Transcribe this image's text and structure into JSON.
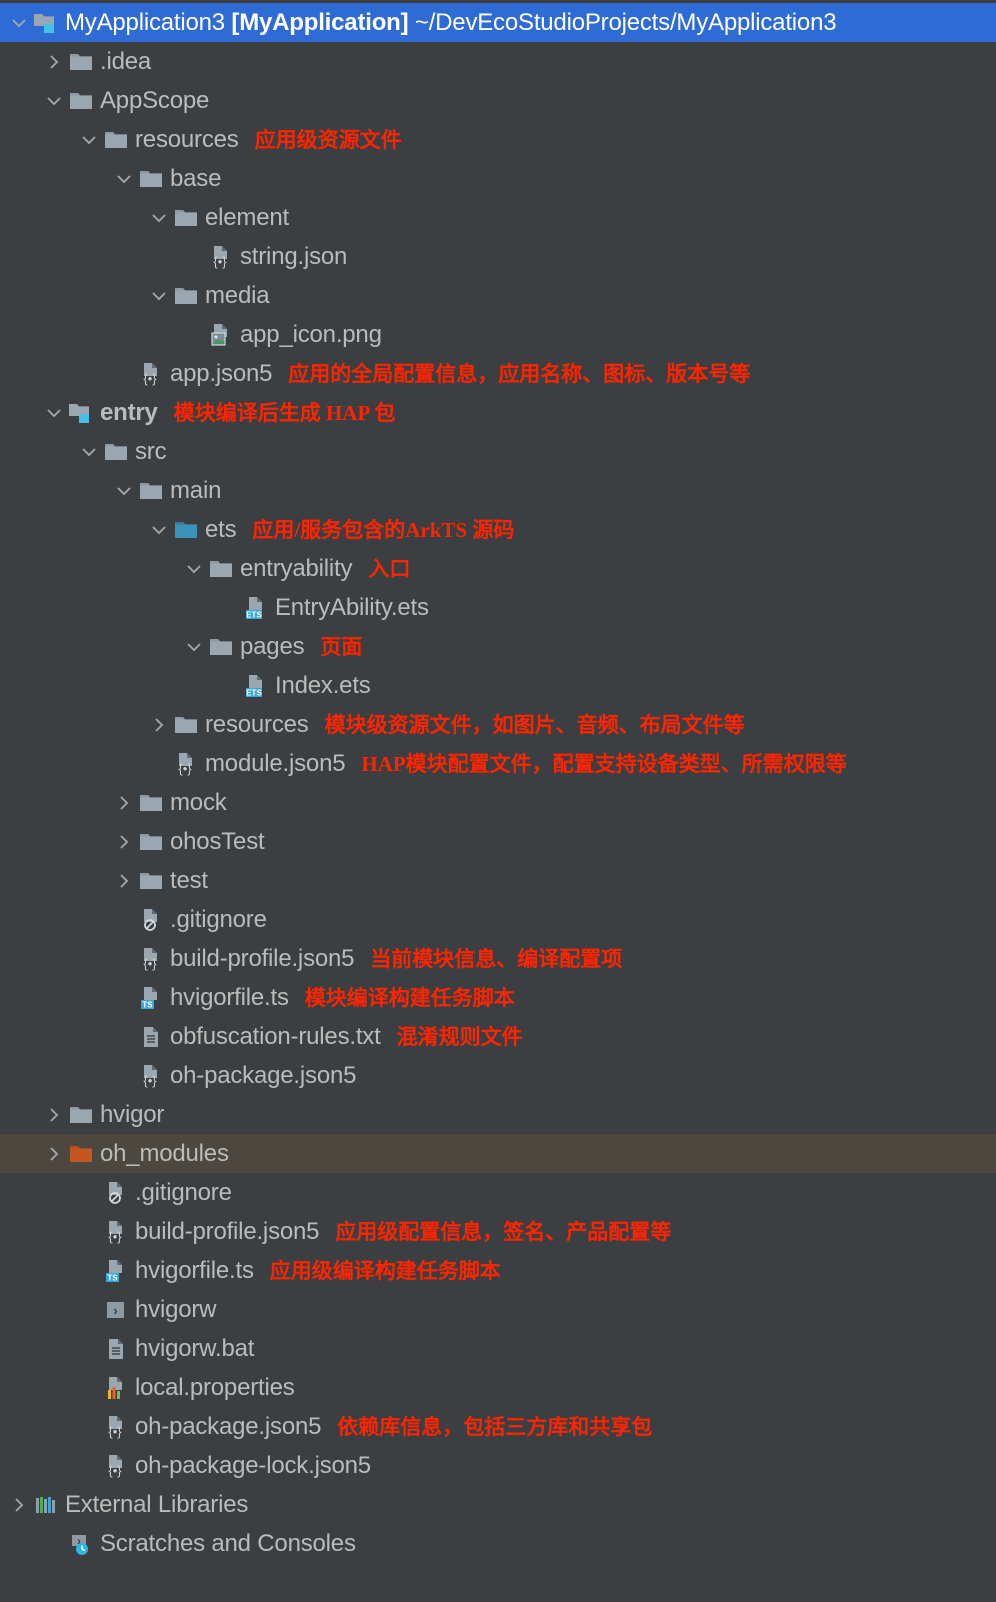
{
  "window": {
    "theme": "dark-ide-project-tree",
    "background_color": "#3c3f41",
    "selected_row_color": "#2f6bd4",
    "highlight_row_color": "#4d483f",
    "label_color": "#bbbbbb",
    "annotation_color": "#ff2400"
  },
  "tree": {
    "rows": [
      {
        "id": "root",
        "label": "MyApplication3 ",
        "label_bold": "[MyApplication]",
        "label_tail": " ~/DevEcoStudioProjects/MyApplication3",
        "indent": 0,
        "arrow": "down",
        "icon": "module-folder-icon",
        "state": "selected",
        "note": ""
      },
      {
        "id": "idea",
        "label": ".idea",
        "indent": 1,
        "arrow": "right",
        "icon": "folder-icon",
        "state": "normal",
        "note": ""
      },
      {
        "id": "appscope",
        "label": "AppScope",
        "indent": 1,
        "arrow": "down",
        "icon": "folder-icon",
        "state": "normal",
        "note": ""
      },
      {
        "id": "appscope-resources",
        "label": "resources",
        "indent": 2,
        "arrow": "down",
        "icon": "folder-icon",
        "state": "normal",
        "note": "应用级资源文件"
      },
      {
        "id": "appscope-base",
        "label": "base",
        "indent": 3,
        "arrow": "down",
        "icon": "folder-icon",
        "state": "normal",
        "note": ""
      },
      {
        "id": "appscope-element",
        "label": "element",
        "indent": 4,
        "arrow": "down",
        "icon": "folder-icon",
        "state": "normal",
        "note": ""
      },
      {
        "id": "string-json",
        "label": "string.json",
        "indent": 5,
        "arrow": "none",
        "icon": "json-file-icon",
        "state": "normal",
        "note": ""
      },
      {
        "id": "appscope-media",
        "label": "media",
        "indent": 4,
        "arrow": "down",
        "icon": "folder-icon",
        "state": "normal",
        "note": ""
      },
      {
        "id": "app-icon-png",
        "label": "app_icon.png",
        "indent": 5,
        "arrow": "none",
        "icon": "image-file-icon",
        "state": "normal",
        "note": ""
      },
      {
        "id": "app-json5",
        "label": "app.json5",
        "indent": 3,
        "arrow": "none",
        "icon": "json-file-icon",
        "state": "normal",
        "note": "应用的全局配置信息，应用名称、图标、版本号等"
      },
      {
        "id": "entry",
        "label": "entry",
        "label_weight": "bold",
        "indent": 1,
        "arrow": "down",
        "icon": "module-folder-icon",
        "state": "normal",
        "note": "模块编译后生成 HAP 包"
      },
      {
        "id": "entry-src",
        "label": "src",
        "indent": 2,
        "arrow": "down",
        "icon": "folder-icon",
        "state": "normal",
        "note": ""
      },
      {
        "id": "entry-main",
        "label": "main",
        "indent": 3,
        "arrow": "down",
        "icon": "folder-icon",
        "state": "normal",
        "note": ""
      },
      {
        "id": "entry-ets",
        "label": "ets",
        "indent": 4,
        "arrow": "down",
        "icon": "source-folder-icon",
        "state": "normal",
        "note": "应用/服务包含的ArkTS 源码"
      },
      {
        "id": "entryability",
        "label": "entryability",
        "indent": 5,
        "arrow": "down",
        "icon": "folder-icon",
        "state": "normal",
        "note": "入口"
      },
      {
        "id": "entryability-ets",
        "label": "EntryAbility.ets",
        "indent": 6,
        "arrow": "none",
        "icon": "ets-file-icon",
        "state": "normal",
        "note": ""
      },
      {
        "id": "pages",
        "label": "pages",
        "indent": 5,
        "arrow": "down",
        "icon": "folder-icon",
        "state": "normal",
        "note": "页面"
      },
      {
        "id": "index-ets",
        "label": "Index.ets",
        "indent": 6,
        "arrow": "none",
        "icon": "ets-file-icon",
        "state": "normal",
        "note": ""
      },
      {
        "id": "entry-resources",
        "label": "resources",
        "indent": 4,
        "arrow": "right",
        "icon": "folder-icon",
        "state": "normal",
        "note": "模块级资源文件，如图片、音频、布局文件等"
      },
      {
        "id": "module-json5",
        "label": "module.json5",
        "indent": 4,
        "arrow": "none",
        "icon": "json-file-icon",
        "state": "normal",
        "note": "HAP模块配置文件，配置支持设备类型、所需权限等"
      },
      {
        "id": "mock",
        "label": "mock",
        "indent": 3,
        "arrow": "right",
        "icon": "folder-icon",
        "state": "normal",
        "note": ""
      },
      {
        "id": "ohostest",
        "label": "ohosTest",
        "indent": 3,
        "arrow": "right",
        "icon": "folder-icon",
        "state": "normal",
        "note": ""
      },
      {
        "id": "test",
        "label": "test",
        "indent": 3,
        "arrow": "right",
        "icon": "folder-icon",
        "state": "normal",
        "note": ""
      },
      {
        "id": "entry-gitignore",
        "label": ".gitignore",
        "indent": 3,
        "arrow": "none",
        "icon": "gitignore-file-icon",
        "state": "normal",
        "note": ""
      },
      {
        "id": "entry-build-profile",
        "label": "build-profile.json5",
        "indent": 3,
        "arrow": "none",
        "icon": "json-file-icon",
        "state": "normal",
        "note": "当前模块信息、编译配置项"
      },
      {
        "id": "entry-hvigorfile",
        "label": "hvigorfile.ts",
        "indent": 3,
        "arrow": "none",
        "icon": "ts-file-icon",
        "state": "normal",
        "note": "模块编译构建任务脚本"
      },
      {
        "id": "obfuscation-rules",
        "label": "obfuscation-rules.txt",
        "indent": 3,
        "arrow": "none",
        "icon": "text-file-icon",
        "state": "normal",
        "note": "混淆规则文件"
      },
      {
        "id": "entry-oh-package",
        "label": "oh-package.json5",
        "indent": 3,
        "arrow": "none",
        "icon": "json-file-icon",
        "state": "normal",
        "note": ""
      },
      {
        "id": "hvigor",
        "label": "hvigor",
        "indent": 1,
        "arrow": "right",
        "icon": "folder-icon",
        "state": "normal",
        "note": ""
      },
      {
        "id": "oh-modules",
        "label": "oh_modules",
        "indent": 1,
        "arrow": "right",
        "icon": "orange-folder-icon",
        "state": "highlighted",
        "note": ""
      },
      {
        "id": "root-gitignore",
        "label": ".gitignore",
        "indent": 2,
        "arrow": "none",
        "icon": "gitignore-file-icon",
        "state": "normal",
        "note": ""
      },
      {
        "id": "root-build-profile",
        "label": "build-profile.json5",
        "indent": 2,
        "arrow": "none",
        "icon": "json-file-icon",
        "state": "normal",
        "note": "应用级配置信息，签名、产品配置等"
      },
      {
        "id": "root-hvigorfile",
        "label": "hvigorfile.ts",
        "indent": 2,
        "arrow": "none",
        "icon": "ts-file-icon",
        "state": "normal",
        "note": "应用级编译构建任务脚本"
      },
      {
        "id": "hvigorw",
        "label": "hvigorw",
        "indent": 2,
        "arrow": "none",
        "icon": "script-file-icon",
        "state": "normal",
        "note": ""
      },
      {
        "id": "hvigorw-bat",
        "label": "hvigorw.bat",
        "indent": 2,
        "arrow": "none",
        "icon": "text-file-icon",
        "state": "normal",
        "note": ""
      },
      {
        "id": "local-properties",
        "label": "local.properties",
        "indent": 2,
        "arrow": "none",
        "icon": "properties-file-icon",
        "state": "normal",
        "note": ""
      },
      {
        "id": "root-oh-package",
        "label": "oh-package.json5",
        "indent": 2,
        "arrow": "none",
        "icon": "json-file-icon",
        "state": "normal",
        "note": "依赖库信息，包括三方库和共享包"
      },
      {
        "id": "root-oh-package-lock",
        "label": "oh-package-lock.json5",
        "indent": 2,
        "arrow": "none",
        "icon": "json-file-icon",
        "state": "normal",
        "note": ""
      },
      {
        "id": "external-libraries",
        "label": "External Libraries",
        "indent": 0,
        "arrow": "right",
        "icon": "libraries-icon",
        "state": "normal",
        "note": ""
      },
      {
        "id": "scratches-and-consoles",
        "label": "Scratches and Consoles",
        "indent": 1,
        "arrow": "none",
        "icon": "scratches-icon",
        "state": "normal",
        "note": ""
      }
    ]
  }
}
